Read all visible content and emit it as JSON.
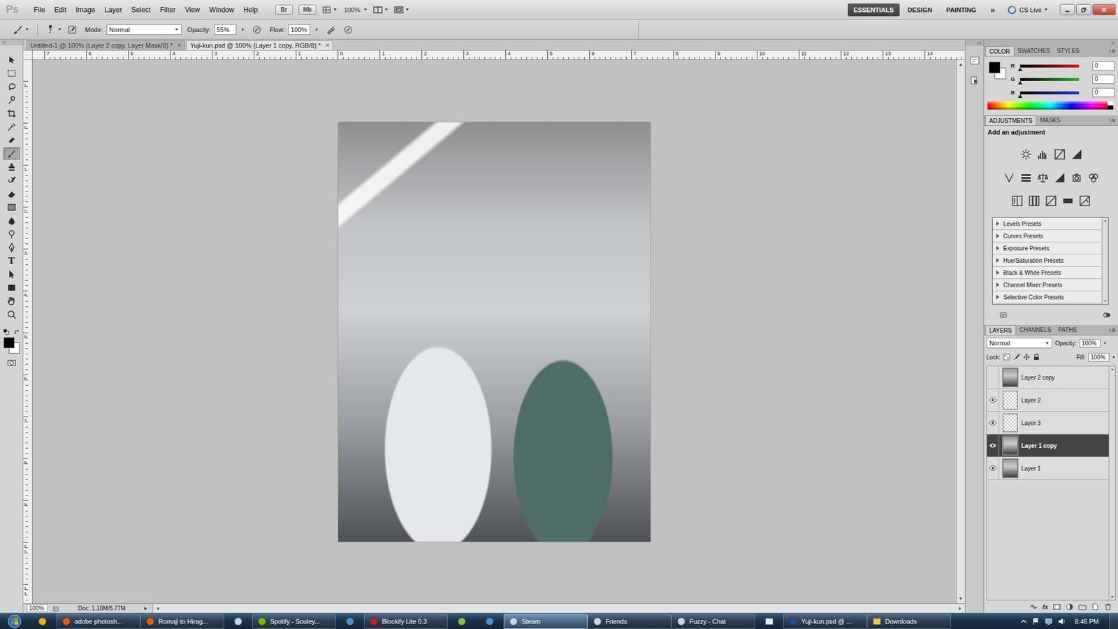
{
  "app": {
    "logo": "Ps"
  },
  "menu": [
    "File",
    "Edit",
    "Image",
    "Layer",
    "Select",
    "Filter",
    "View",
    "Window",
    "Help"
  ],
  "app_bar": {
    "bridge": "Br",
    "mini_bridge": "Mb",
    "zoom": "100%"
  },
  "workspaces": [
    {
      "label": "ESSENTIALS",
      "selected": true
    },
    {
      "label": "DESIGN",
      "selected": false
    },
    {
      "label": "PAINTING",
      "selected": false
    }
  ],
  "more": "»",
  "cs_live": "CS Live",
  "options": {
    "brush_size": "7",
    "mode_label": "Mode:",
    "mode": "Normal",
    "opacity_label": "Opacity:",
    "opacity": "55%",
    "flow_label": "Flow:",
    "flow": "100%"
  },
  "tools": [
    {
      "kind": "move",
      "selected": false
    },
    {
      "kind": "marquee",
      "selected": false
    },
    {
      "kind": "lasso",
      "selected": false
    },
    {
      "kind": "quick-select",
      "selected": false
    },
    {
      "kind": "crop",
      "selected": false
    },
    {
      "kind": "eyedropper",
      "selected": false
    },
    {
      "kind": "healing",
      "selected": false
    },
    {
      "kind": "brush",
      "selected": true
    },
    {
      "kind": "stamp",
      "selected": false
    },
    {
      "kind": "history-brush",
      "selected": false
    },
    {
      "kind": "eraser",
      "selected": false
    },
    {
      "kind": "gradient",
      "selected": false
    },
    {
      "kind": "blur",
      "selected": false
    },
    {
      "kind": "dodge",
      "selected": false
    },
    {
      "kind": "pen",
      "selected": false
    },
    {
      "kind": "type",
      "glyph": "T",
      "selected": false
    },
    {
      "kind": "path-select",
      "selected": false
    },
    {
      "kind": "shape",
      "selected": false
    },
    {
      "kind": "hand",
      "selected": false
    },
    {
      "kind": "zoom",
      "selected": false
    }
  ],
  "colors": {
    "foreground": "#000000",
    "background": "#ffffff"
  },
  "documents": [
    {
      "label": "Untitled-1 @ 100% (Layer 2 copy, Layer Mask/8) *",
      "close": "×",
      "selected": false
    },
    {
      "label": "Yuji-kun.psd @ 100% (Layer 1 copy, RGB/8) *",
      "close": "×",
      "selected": true
    }
  ],
  "ruler": {
    "horizontal": [
      "7",
      "6",
      "5",
      "4",
      "3",
      "2",
      "1",
      "0",
      "1",
      "2",
      "3",
      "4",
      "5",
      "6",
      "7",
      "8",
      "9",
      "10",
      "11",
      "12",
      "13",
      "14"
    ],
    "vertical": [
      "1",
      "0",
      "1",
      "2",
      "3",
      "4",
      "5",
      "6",
      "7",
      "8",
      "9",
      "10",
      "11"
    ]
  },
  "status": {
    "zoom": "100%",
    "doc": "Doc: 1.10M/5.77M"
  },
  "color_panel": {
    "tabs": [
      {
        "label": "COLOR",
        "selected": true
      },
      {
        "label": "SWATCHES",
        "selected": false
      },
      {
        "label": "STYLES",
        "selected": false
      }
    ],
    "channels": [
      {
        "name": "R",
        "value": "0",
        "level": 0,
        "color": "#e01818"
      },
      {
        "name": "G",
        "value": "0",
        "level": 0,
        "color": "#22b022"
      },
      {
        "name": "B",
        "value": "0",
        "level": 0,
        "color": "#2030d0"
      }
    ]
  },
  "adjustments_panel": {
    "tabs": [
      {
        "label": "ADJUSTMENTS",
        "selected": true
      },
      {
        "label": "MASKS",
        "selected": false
      }
    ],
    "title": "Add an adjustment",
    "presets": [
      {
        "label": "Levels Presets",
        "expanded": false
      },
      {
        "label": "Curves Presets",
        "expanded": false
      },
      {
        "label": "Exposure Presets",
        "expanded": false
      },
      {
        "label": "Hue/Saturation Presets",
        "expanded": false
      },
      {
        "label": "Black & White Presets",
        "expanded": false
      },
      {
        "label": "Channel Mixer Presets",
        "expanded": false
      },
      {
        "label": "Selective Color Presets",
        "expanded": false
      }
    ]
  },
  "layers_panel": {
    "tabs": [
      {
        "label": "LAYERS",
        "selected": true
      },
      {
        "label": "CHANNELS",
        "selected": false
      },
      {
        "label": "PATHS",
        "selected": false
      }
    ],
    "blend_mode": "Normal",
    "opacity_label": "Opacity:",
    "opacity": "100%",
    "lock_label": "Lock:",
    "fill_label": "Fill:",
    "fill": "100%",
    "fx": "fx",
    "layers": [
      {
        "name": "Layer 2 copy",
        "visible": false,
        "selected": false,
        "kind": "photo"
      },
      {
        "name": "Layer 2",
        "visible": true,
        "selected": false,
        "kind": "transparent"
      },
      {
        "name": "Layer 3",
        "visible": true,
        "selected": false,
        "kind": "transparent"
      },
      {
        "name": "Layer 1 copy",
        "visible": true,
        "selected": true,
        "kind": "photo"
      },
      {
        "name": "Layer 1",
        "visible": true,
        "selected": false,
        "kind": "photo"
      }
    ]
  },
  "taskbar": {
    "items": [
      {
        "kind": "chrome",
        "selected": false
      },
      {
        "kind": "firefox",
        "label": "adobe photosh...",
        "selected": false
      },
      {
        "kind": "firefox",
        "label": "Romaji to Hirag...",
        "selected": false
      },
      {
        "kind": "steam",
        "selected": false
      },
      {
        "kind": "spotify",
        "label": "Spotify - Souley...",
        "selected": false
      },
      {
        "kind": "app",
        "selected": false
      },
      {
        "kind": "blockify",
        "label": "Blockify Lite 0.3",
        "selected": false
      },
      {
        "kind": "utorrent",
        "selected": false
      },
      {
        "kind": "app",
        "selected": false
      },
      {
        "kind": "steam",
        "label": "Steam",
        "selected": true
      },
      {
        "kind": "steam",
        "label": "Friends",
        "selected": false
      },
      {
        "kind": "steam",
        "label": "Fuzzy - Chat",
        "selected": false
      },
      {
        "kind": "window",
        "selected": false
      },
      {
        "kind": "photoshop",
        "label": "Yuji-kun.psd @ ...",
        "selected": false
      },
      {
        "kind": "folder",
        "label": "Downloads",
        "selected": false
      }
    ],
    "clock": "8:46 PM"
  }
}
